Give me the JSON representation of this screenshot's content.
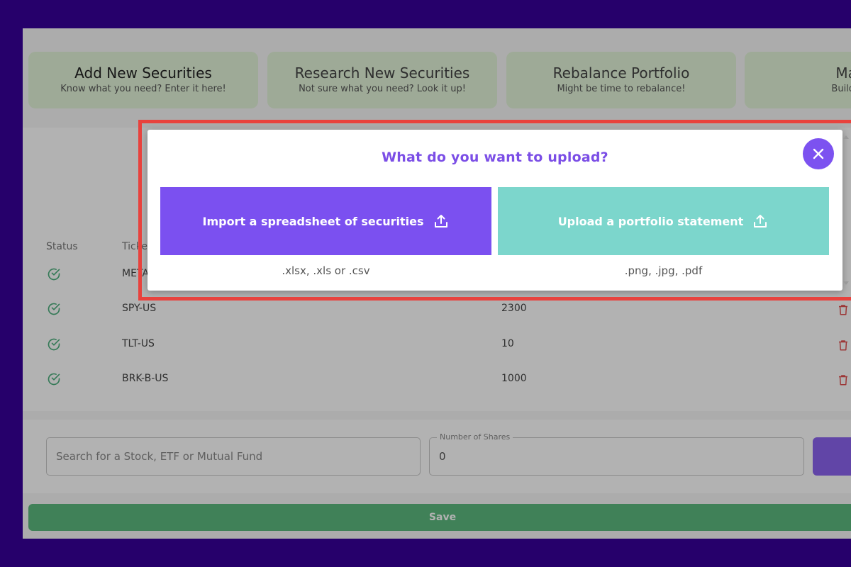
{
  "cards": [
    {
      "title": "Add New Securities",
      "subtitle": "Know what you need? Enter it here!"
    },
    {
      "title": "Research New Securities",
      "subtitle": "Not sure what you need? Look it up!"
    },
    {
      "title": "Rebalance Portfolio",
      "subtitle": "Might be time to rebalance!"
    },
    {
      "title": "Manag",
      "subtitle": "Build from e"
    }
  ],
  "table": {
    "headers": {
      "status": "Status",
      "ticker": "Ticke"
    },
    "rows": [
      {
        "ticker": "META",
        "shares": ""
      },
      {
        "ticker": "SPY-US",
        "shares": "2300"
      },
      {
        "ticker": "TLT-US",
        "shares": "10"
      },
      {
        "ticker": "BRK-B-US",
        "shares": "1000"
      }
    ]
  },
  "add_form": {
    "search_placeholder": "Search for a Stock, ETF or Mutual Fund",
    "shares_label": "Number of Shares",
    "shares_value": "0"
  },
  "save_label": "Save",
  "modal": {
    "title": "What do you want to upload?",
    "options": [
      {
        "label": "Import a spreadsheet of securities",
        "hint": ".xlsx, .xls or .csv",
        "color": "#7b50f0"
      },
      {
        "label": "Upload a portfolio statement",
        "hint": ".png, .jpg, .pdf",
        "color": "#7cd6cc"
      }
    ]
  },
  "colors": {
    "page_bg": "#26006b",
    "accent": "#7b4ee6",
    "highlight": "#e8423d",
    "save": "#5cb97f",
    "card_bg": "#e2f4d9",
    "status_ok": "#4caf7d",
    "delete": "#e05050"
  },
  "icons": {
    "close": "close-icon",
    "upload": "upload-icon",
    "status": "check-circle-icon",
    "delete": "trash-icon"
  }
}
